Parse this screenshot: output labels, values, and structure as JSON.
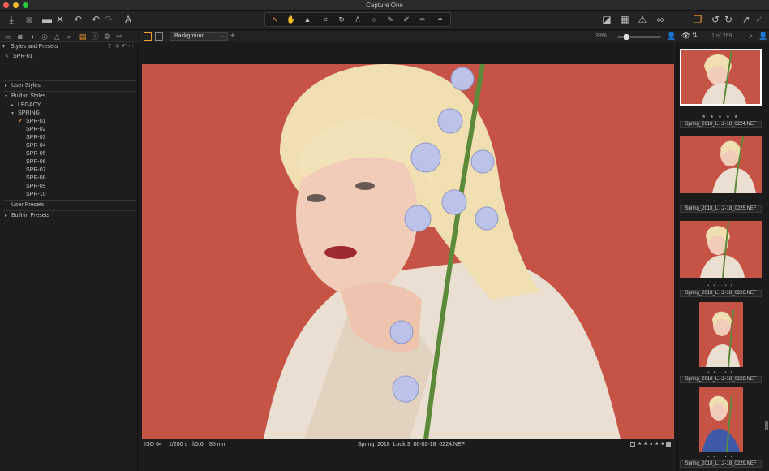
{
  "window": {
    "title": "Capture One"
  },
  "colors": {
    "accent": "#f29b2e",
    "close": "#fc5f57",
    "minimize": "#fdbc2e",
    "zoom": "#28c840",
    "backdrop": "#c55346"
  },
  "toolbar": {
    "left_icons": [
      "import-icon",
      "camera-icon",
      "folder-icon",
      "delete-icon",
      "reset-icon",
      "undo-icon",
      "redo-icon",
      "text-icon"
    ],
    "tools": [
      "select-icon",
      "pan-icon",
      "loupe-icon",
      "crop-icon",
      "rotate-icon",
      "keystone-icon",
      "circle-icon",
      "brush-icon",
      "picker-icon",
      "eraser-icon",
      "annotate-icon"
    ],
    "right_icons": [
      "proof-icon",
      "grid-icon",
      "warning-icon",
      "glasses-icon",
      "stack-icon",
      "rotate-left-icon",
      "rotate-right-icon",
      "cursor-icon",
      "check-icon"
    ]
  },
  "left_panel": {
    "section_title": "Styles and Presets",
    "current_style": "SPR-01",
    "user_styles": "User Styles",
    "builtin_styles": "Built-in Styles",
    "legacy": "LEGACY",
    "spring": "SPRING",
    "styles": [
      "SPR-01",
      "SPR-02",
      "SPR-03",
      "SPR-04",
      "SPR-05",
      "SPR-06",
      "SPR-07",
      "SPR-08",
      "SPR-09",
      "SPR-10"
    ],
    "user_presets": "User Presets",
    "builtin_presets": "Built-in Presets",
    "header_tools": "?"
  },
  "viewer": {
    "background_label": "Background",
    "zoom": "33%",
    "counter": "1 of 269",
    "iso": "ISO 64",
    "shutter": "1/200 s",
    "aperture": "f/5.6",
    "focal": "85 mm",
    "filename": "Spring_2018_Look 3_06-02-18_0224.NEF",
    "rating": "★ ★ ★ ★ ★"
  },
  "browser": {
    "thumbs": [
      {
        "name": "",
        "stars": ""
      },
      {
        "name": "Spring_2018_L...2-18_0224.NEF",
        "stars": "★ ★ ★ ★ ★"
      },
      {
        "name": "Spring_2018_L...2-18_0225.NEF",
        "stars": "• • • • •"
      },
      {
        "name": "Spring_2018_L...2-18_0226.NEF",
        "stars": "• • • • •"
      },
      {
        "name": "Spring_2018_L...2-18_0228.NEF",
        "stars": "• • • • •"
      },
      {
        "name": "Spring_2018_L...2-18_0229.NEF",
        "stars": "• • • • •"
      }
    ]
  }
}
